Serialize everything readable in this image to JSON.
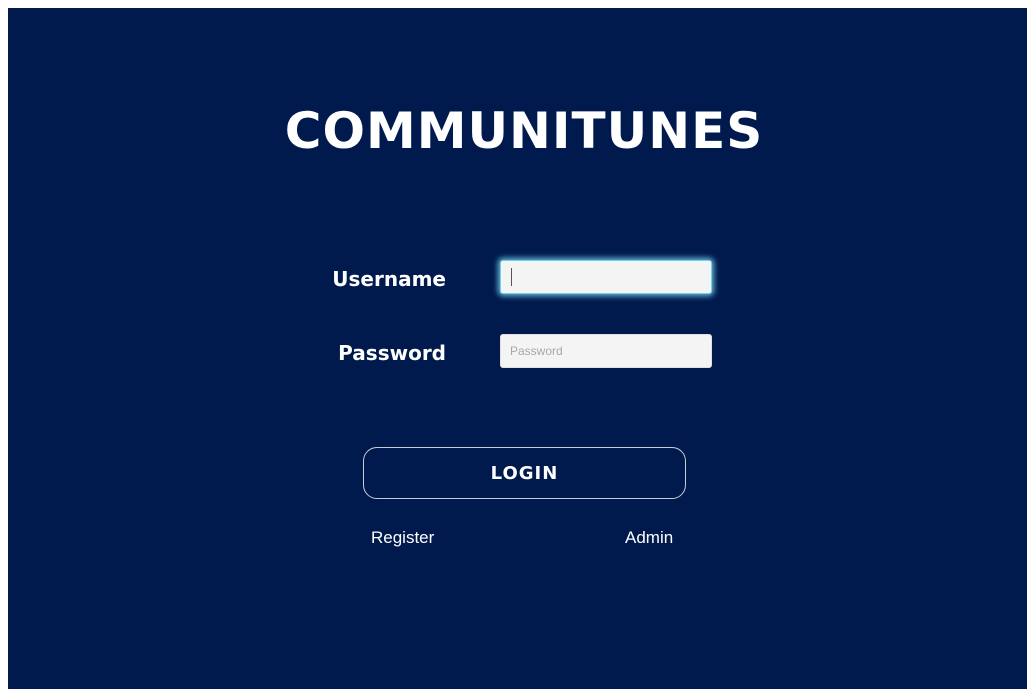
{
  "app": {
    "title": "COMMUNITUNES"
  },
  "form": {
    "username_label": "Username",
    "username_value": "",
    "username_placeholder": "",
    "password_label": "Password",
    "password_value": "",
    "password_placeholder": "Password",
    "login_label": "LOGIN"
  },
  "links": {
    "register": "Register",
    "admin": "Admin"
  },
  "colors": {
    "background": "#011a4e",
    "text": "#ffffff",
    "focus_glow": "#78d7f0",
    "input_bg": "#f4f4f4"
  }
}
